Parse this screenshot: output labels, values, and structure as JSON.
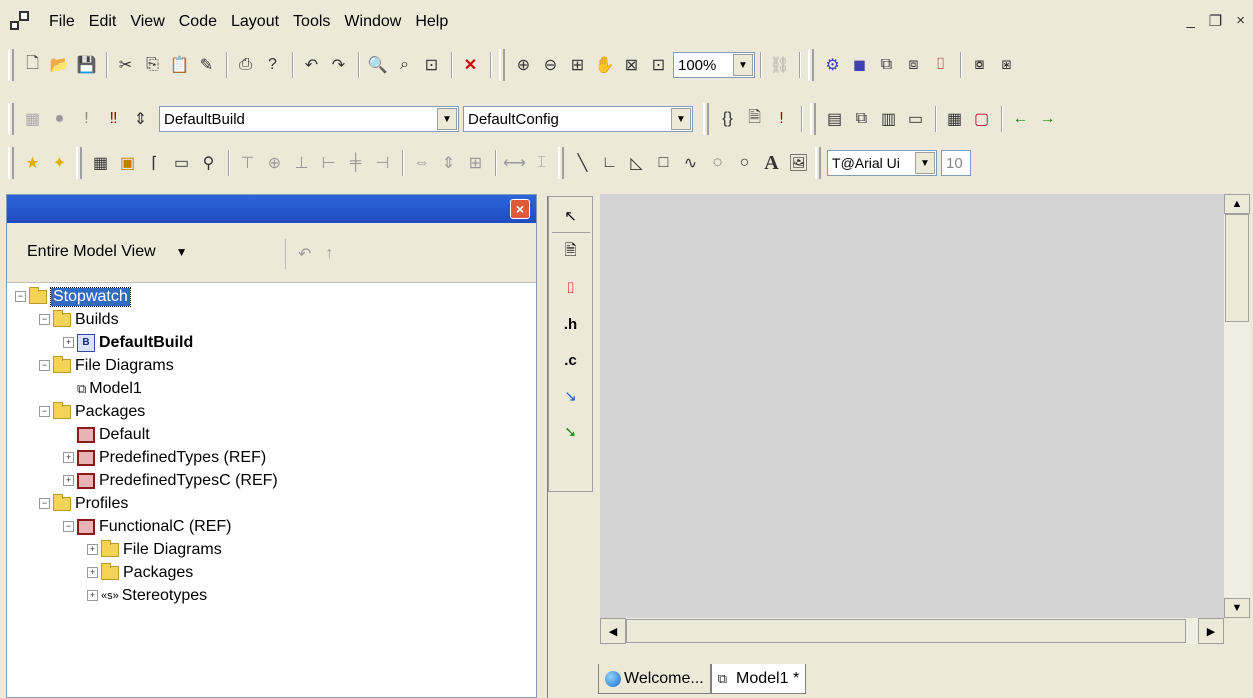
{
  "menubar": {
    "items": [
      "File",
      "Edit",
      "View",
      "Code",
      "Layout",
      "Tools",
      "Window",
      "Help"
    ]
  },
  "window_controls": {
    "minimize": "_",
    "restore": "❐",
    "close": "×"
  },
  "toolbar2": {
    "zoom": "100%"
  },
  "toolbar3": {
    "build": "DefaultBuild",
    "config": "DefaultConfig"
  },
  "toolbar4": {
    "font": "@Arial Ui",
    "size": "10"
  },
  "browser": {
    "view_selector": "Entire Model View",
    "tree": [
      {
        "label": "Stopwatch"
      },
      {
        "label": "Builds"
      },
      {
        "label": "DefaultBuild"
      },
      {
        "label": "File Diagrams"
      },
      {
        "label": "Model1"
      },
      {
        "label": "Packages"
      },
      {
        "label": "Default"
      },
      {
        "label": "PredefinedTypes (REF)"
      },
      {
        "label": "PredefinedTypesC (REF)"
      },
      {
        "label": "Profiles"
      },
      {
        "label": "FunctionalC (REF)"
      },
      {
        "label": "File Diagrams"
      },
      {
        "label": "Packages"
      },
      {
        "label": "Stereotypes"
      }
    ]
  },
  "palette": {
    "h_label": ".h",
    "c_label": ".c"
  },
  "tabs": [
    {
      "label": "Welcome..."
    },
    {
      "label": "Model1 *"
    }
  ]
}
